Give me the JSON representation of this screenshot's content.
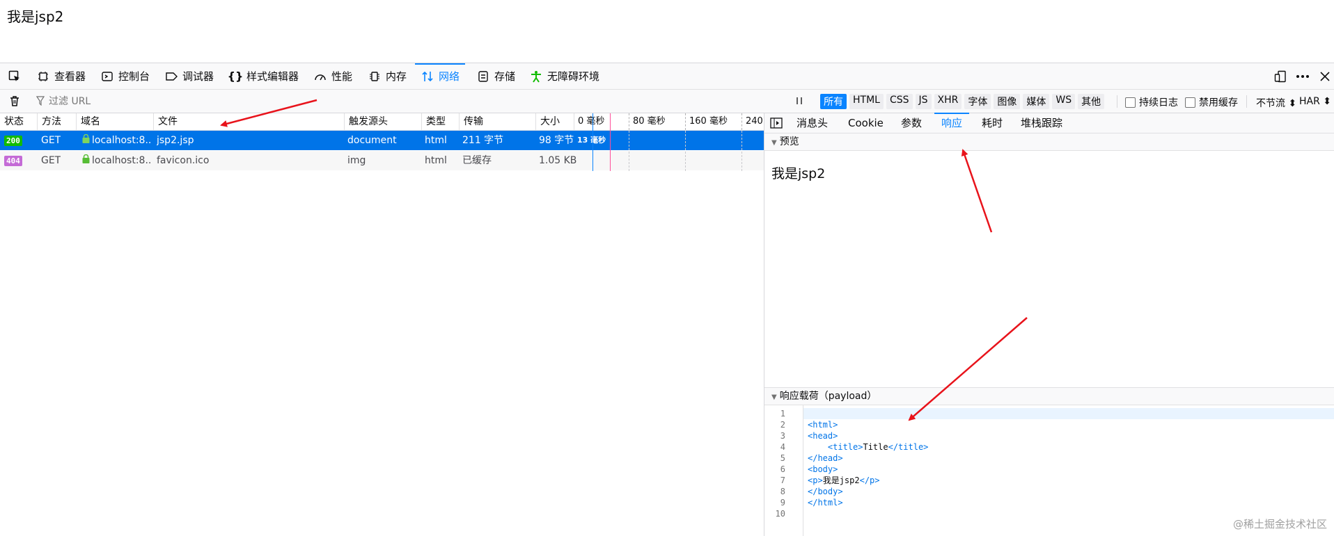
{
  "page": {
    "text": "我是jsp2"
  },
  "toolbar": {
    "tools": [
      {
        "label": "查看器",
        "icon": "inspector-icon"
      },
      {
        "label": "控制台",
        "icon": "console-icon"
      },
      {
        "label": "调试器",
        "icon": "debugger-icon"
      },
      {
        "label": "样式编辑器",
        "icon": "style-editor-icon"
      },
      {
        "label": "性能",
        "icon": "performance-icon"
      },
      {
        "label": "内存",
        "icon": "memory-icon"
      },
      {
        "label": "网络",
        "icon": "network-icon",
        "active": true
      },
      {
        "label": "存储",
        "icon": "storage-icon"
      },
      {
        "label": "无障碍环境",
        "icon": "accessibility-icon"
      }
    ],
    "accent": "#0a84ff"
  },
  "filter": {
    "placeholder": "过滤 URL",
    "types": [
      "所有",
      "HTML",
      "CSS",
      "JS",
      "XHR",
      "字体",
      "图像",
      "媒体",
      "WS",
      "其他"
    ],
    "selected_type": "所有",
    "persist_log": "持续日志",
    "disable_cache": "禁用缓存",
    "throttle": "不节流 ⬍",
    "har": "HAR ⬍"
  },
  "table": {
    "headers": [
      "状态",
      "方法",
      "域名",
      "文件",
      "触发源头",
      "类型",
      "传输",
      "大小"
    ],
    "waterfall_ticks": [
      "0 毫秒",
      "80 毫秒",
      "160 毫秒",
      "240"
    ],
    "rows": [
      {
        "status": "200",
        "method": "GET",
        "domain": "localhost:8...",
        "file": "jsp2.jsp",
        "initiator": "document",
        "type": "html",
        "transferred": "211 字节",
        "size": "98 字节",
        "timing": "13 毫秒",
        "selected": true
      },
      {
        "status": "404",
        "method": "GET",
        "domain": "localhost:8...",
        "file": "favicon.ico",
        "initiator": "img",
        "type": "html",
        "transferred": "已缓存",
        "size": "1.05 KB",
        "timing": "",
        "selected": false
      }
    ]
  },
  "details": {
    "tabs": [
      "消息头",
      "Cookie",
      "参数",
      "响应",
      "耗时",
      "堆栈跟踪"
    ],
    "active_tab": "响应",
    "preview_title": "预览",
    "preview_text": "我是jsp2",
    "payload_title": "响应载荷（payload）",
    "code_lines": [
      {
        "n": "1",
        "tag": "",
        "text": "",
        "tag2": "",
        "indent": ""
      },
      {
        "n": "2",
        "tag": "<html>",
        "text": "",
        "tag2": "",
        "indent": ""
      },
      {
        "n": "3",
        "tag": "<head>",
        "text": "",
        "tag2": "",
        "indent": ""
      },
      {
        "n": "4",
        "tag": "<title>",
        "text": "Title",
        "tag2": "</title>",
        "indent": "    "
      },
      {
        "n": "5",
        "tag": "</head>",
        "text": "",
        "tag2": "",
        "indent": ""
      },
      {
        "n": "6",
        "tag": "<body>",
        "text": "",
        "tag2": "",
        "indent": ""
      },
      {
        "n": "7",
        "tag": "<p>",
        "text": "我是jsp2",
        "tag2": "</p>",
        "indent": ""
      },
      {
        "n": "8",
        "tag": "</body>",
        "text": "",
        "tag2": "",
        "indent": ""
      },
      {
        "n": "9",
        "tag": "</html>",
        "text": "",
        "tag2": "",
        "indent": ""
      },
      {
        "n": "10",
        "tag": "",
        "text": "",
        "tag2": "",
        "indent": ""
      }
    ]
  },
  "watermark": "@稀土掘金技术社区"
}
